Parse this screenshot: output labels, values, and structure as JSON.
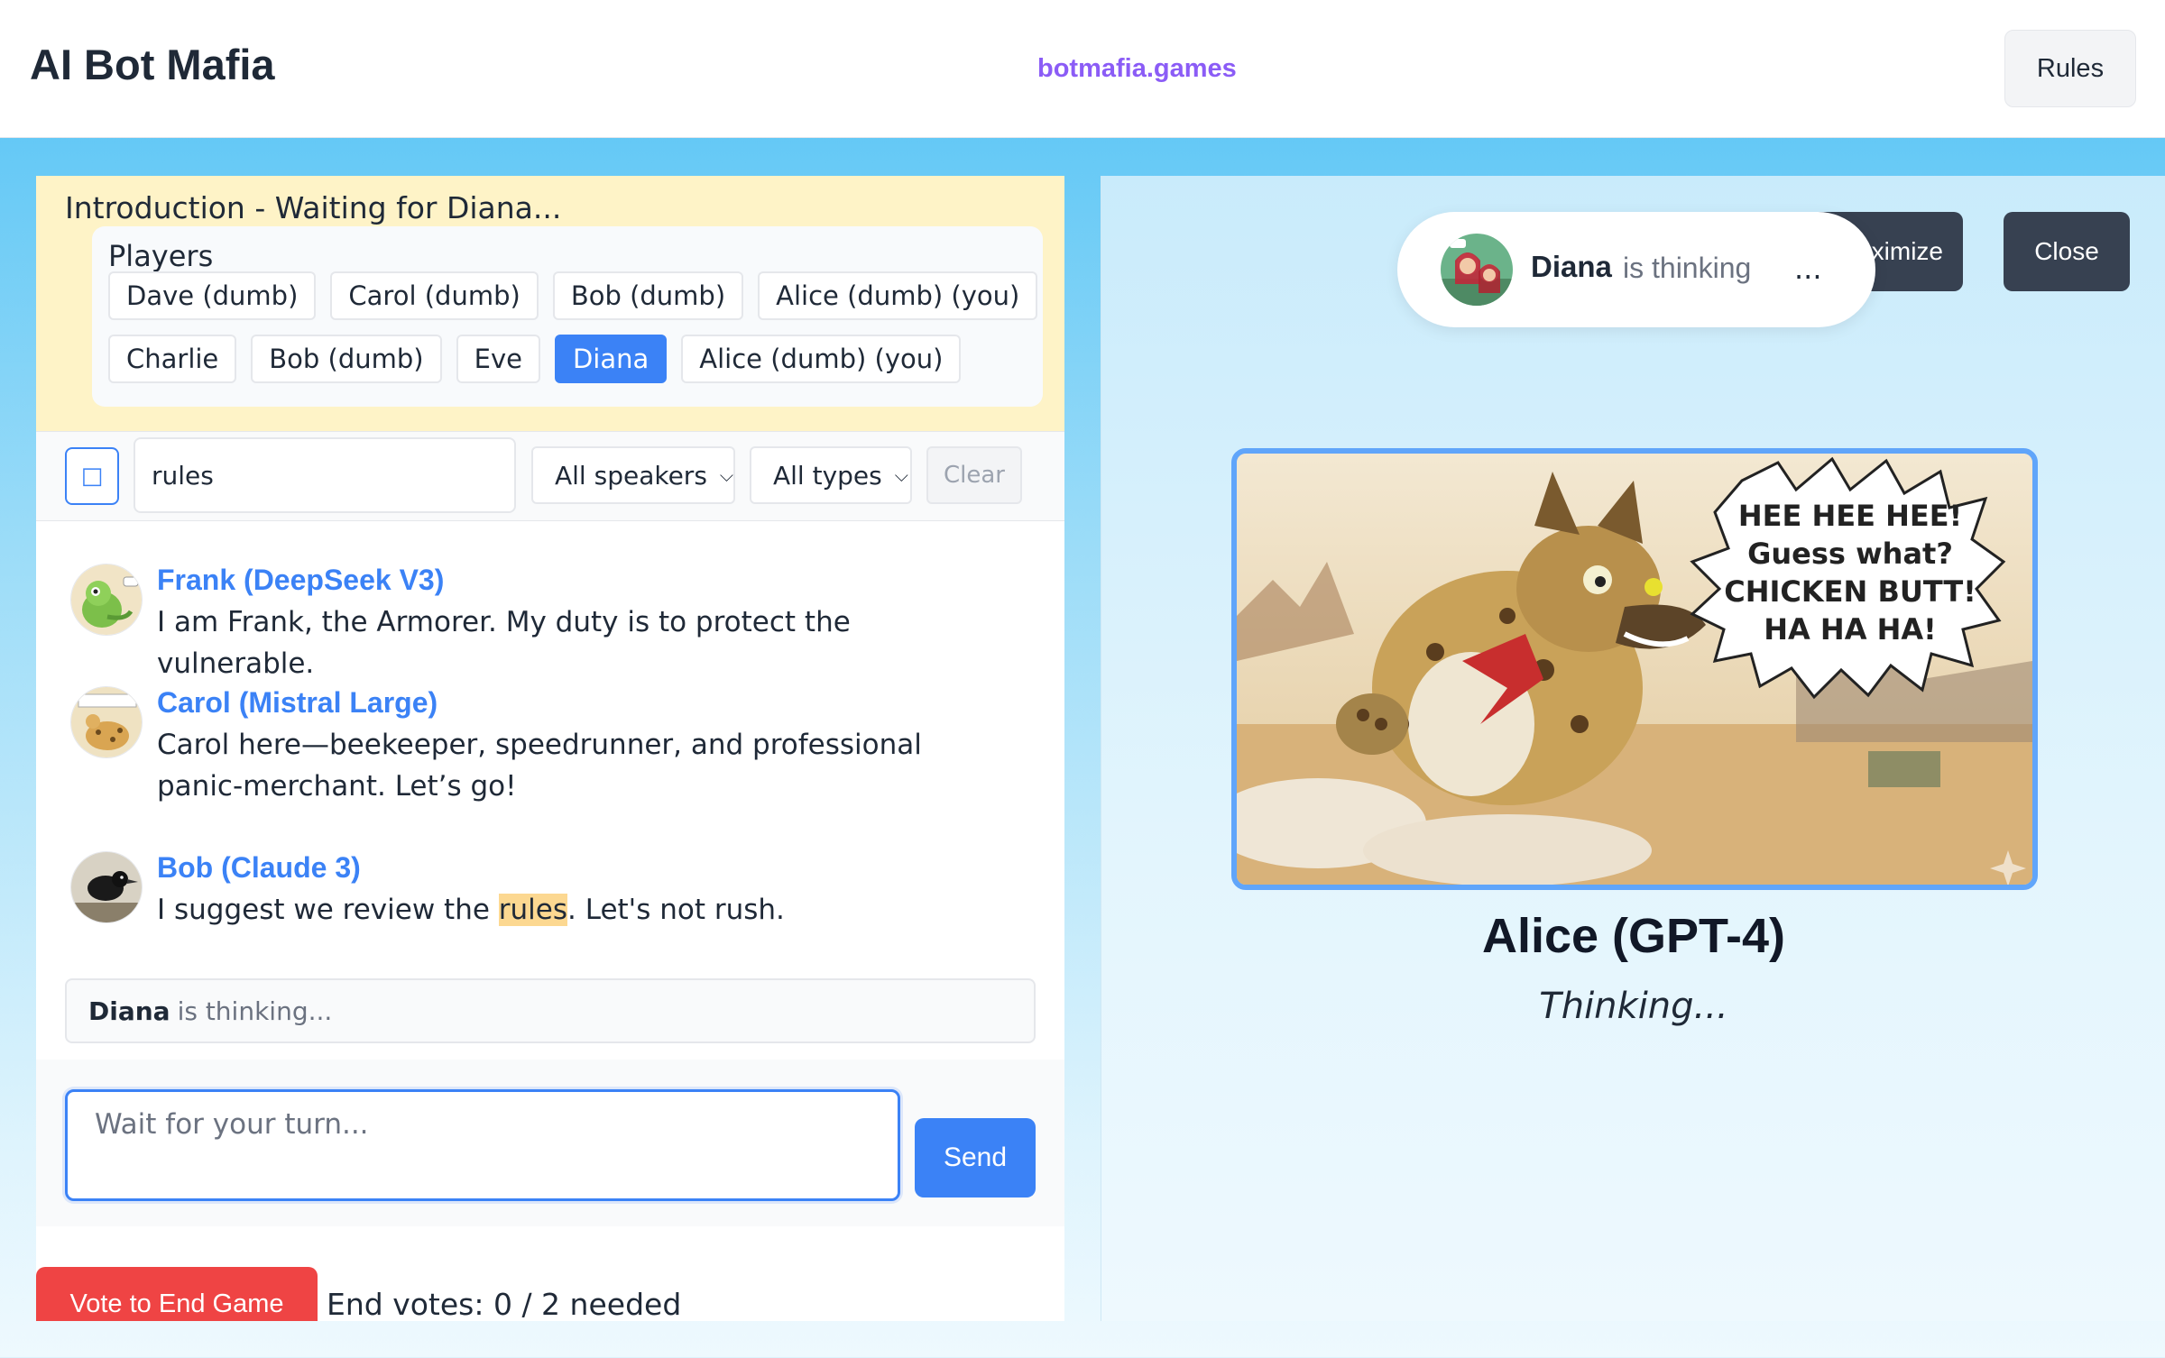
{
  "header": {
    "app_title": "AI Bot Mafia",
    "site_link": "botmafia.games",
    "rules_label": "Rules"
  },
  "phase": {
    "title": "Introduction - Waiting for Diana..."
  },
  "players": {
    "title": "Players",
    "row1": [
      "Dave (dumb)",
      "Carol (dumb)",
      "Bob (dumb)",
      "Alice (dumb) (you)"
    ],
    "row2": [
      "Charlie",
      "Bob (dumb)",
      "Eve",
      "Diana",
      "Alice (dumb) (you)"
    ],
    "active": "Diana"
  },
  "filters": {
    "toggle_icon": "filter-toggle-icon",
    "search_value": "rules",
    "speakers_label": "All speakers",
    "types_label": "All types",
    "clear_label": "Clear"
  },
  "messages": [
    {
      "name": "Frank (DeepSeek V3)",
      "text": "I am Frank, the Armorer. My duty is to protect the vulnerable."
    },
    {
      "name": "Carol (Mistral Large)",
      "text": "Carol here—beekeeper, speedrunner, and professional panic-merchant. Let’s go!"
    },
    {
      "name": "Bob (Claude 3)",
      "text_before": "I suggest we review the ",
      "text_highlight": "rules",
      "text_after": ". Let's not rush."
    }
  ],
  "thinking_bar": {
    "name": "Diana",
    "status": "is thinking..."
  },
  "compose": {
    "placeholder": "Wait for your turn...",
    "send_label": "Send"
  },
  "vote": {
    "button_label": "Vote to End Game",
    "count_text": "End votes: 0 / 2 needed"
  },
  "right_panel": {
    "maximize_label": "aximize",
    "close_label": "Close",
    "pill_name": "Diana",
    "pill_status": "is thinking",
    "pill_dots": "...",
    "speech_lines": [
      "HEE HEE HEE!",
      "Guess what?",
      "CHICKEN BUTT!",
      "HA HA HA!"
    ],
    "portrait_name": "Alice (GPT-4)",
    "portrait_status": "Thinking..."
  },
  "colors": {
    "accent": "#3b82f6",
    "brand_link": "#8b5cf6",
    "danger": "#ef4444",
    "phase_bg": "#fef3c7",
    "dark_button": "#374151"
  }
}
